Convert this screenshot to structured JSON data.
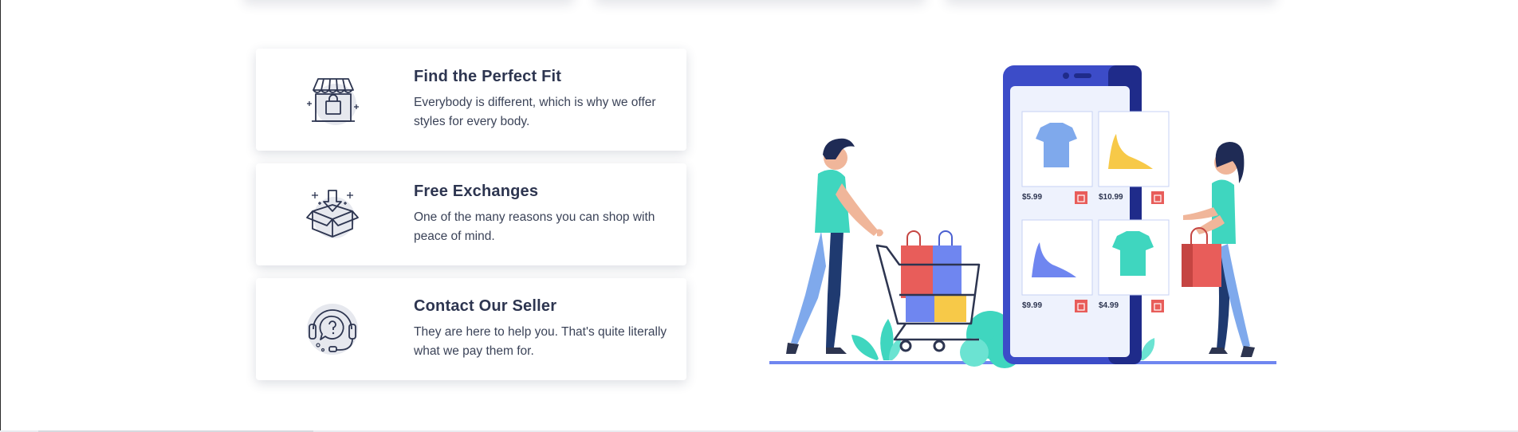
{
  "features": [
    {
      "icon": "storefront-bag-icon",
      "title": "Find the Perfect Fit",
      "description": "Everybody is different, which is why we offer styles for every body."
    },
    {
      "icon": "open-box-arrow-icon",
      "title": "Free Exchanges",
      "description": "One of the many reasons you can shop with peace of mind."
    },
    {
      "icon": "headset-support-icon",
      "title": "Contact Our Seller",
      "description": "They are here to help you. That's quite literally what we pay them for."
    }
  ],
  "illustration": {
    "name": "online-shopping-illustration",
    "prices": [
      "$5.99",
      "$10.99",
      "$9.99",
      "$4.99"
    ]
  },
  "colors": {
    "text": "#2d3550",
    "phone": "#3c4cc8",
    "accent_teal": "#3fd6bf",
    "accent_red": "#e85d5a",
    "accent_yellow": "#f7c948",
    "accent_blue": "#6f86f0"
  }
}
